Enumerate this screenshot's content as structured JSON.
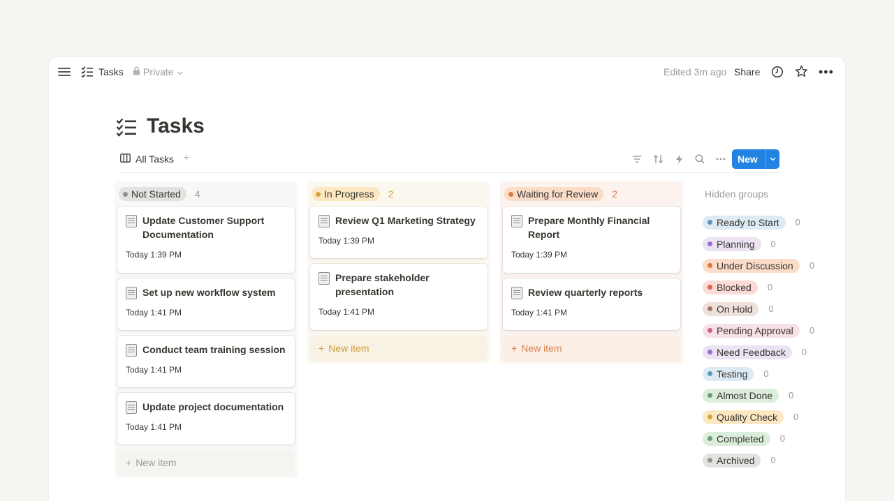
{
  "topbar": {
    "title": "Tasks",
    "privacy": "Private",
    "edited": "Edited 3m ago",
    "share": "Share",
    "more": "•••"
  },
  "page": {
    "title": "Tasks",
    "view_tab": "All Tasks",
    "view_add": "+",
    "new_button": "New"
  },
  "columns": [
    {
      "label": "Not Started",
      "count": "4",
      "color": "#91918e",
      "cards": [
        {
          "title": "Update Customer Support Documentation",
          "date": "Today 1:39 PM"
        },
        {
          "title": "Set up new workflow system",
          "date": "Today 1:41 PM"
        },
        {
          "title": "Conduct team training session",
          "date": "Today 1:41 PM"
        },
        {
          "title": "Update project documentation",
          "date": "Today 1:41 PM"
        }
      ],
      "new_item": "New item"
    },
    {
      "label": "In Progress",
      "count": "2",
      "color": "#d9a13e",
      "cards": [
        {
          "title": "Review Q1 Marketing Strategy",
          "date": "Today 1:39 PM"
        },
        {
          "title": "Prepare stakeholder presentation",
          "date": "Today 1:41 PM"
        }
      ],
      "new_item": "New item"
    },
    {
      "label": "Waiting for Review",
      "count": "2",
      "color": "#d97a42",
      "cards": [
        {
          "title": "Prepare Monthly Financial Report",
          "date": "Today 1:39 PM"
        },
        {
          "title": "Review quarterly reports",
          "date": "Today 1:41 PM"
        }
      ],
      "new_item": "New item"
    }
  ],
  "hidden_groups": {
    "title": "Hidden groups",
    "items": [
      {
        "label": "Ready to Start",
        "count": "0",
        "bg": "#dde9f3",
        "dot": "#5b97bd"
      },
      {
        "label": "Planning",
        "count": "0",
        "bg": "#ebe2f2",
        "dot": "#9a6dd7"
      },
      {
        "label": "Under Discussion",
        "count": "0",
        "bg": "#fadcc9",
        "dot": "#d97a42"
      },
      {
        "label": "Blocked",
        "count": "0",
        "bg": "#fbdbd7",
        "dot": "#e0624f"
      },
      {
        "label": "On Hold",
        "count": "0",
        "bg": "#eee0da",
        "dot": "#a27763"
      },
      {
        "label": "Pending Approval",
        "count": "0",
        "bg": "#f8e0e7",
        "dot": "#d15f8a"
      },
      {
        "label": "Need Feedback",
        "count": "0",
        "bg": "#ebe2f2",
        "dot": "#9a6dd7"
      },
      {
        "label": "Testing",
        "count": "0",
        "bg": "#dde9f3",
        "dot": "#5b97bd"
      },
      {
        "label": "Almost Done",
        "count": "0",
        "bg": "#dbeddb",
        "dot": "#6c9b7d"
      },
      {
        "label": "Quality Check",
        "count": "0",
        "bg": "#fbe8c3",
        "dot": "#d9a13e"
      },
      {
        "label": "Completed",
        "count": "0",
        "bg": "#dbeddb",
        "dot": "#6c9b7d"
      },
      {
        "label": "Archived",
        "count": "0",
        "bg": "#e3e2e0",
        "dot": "#91918e"
      }
    ]
  }
}
